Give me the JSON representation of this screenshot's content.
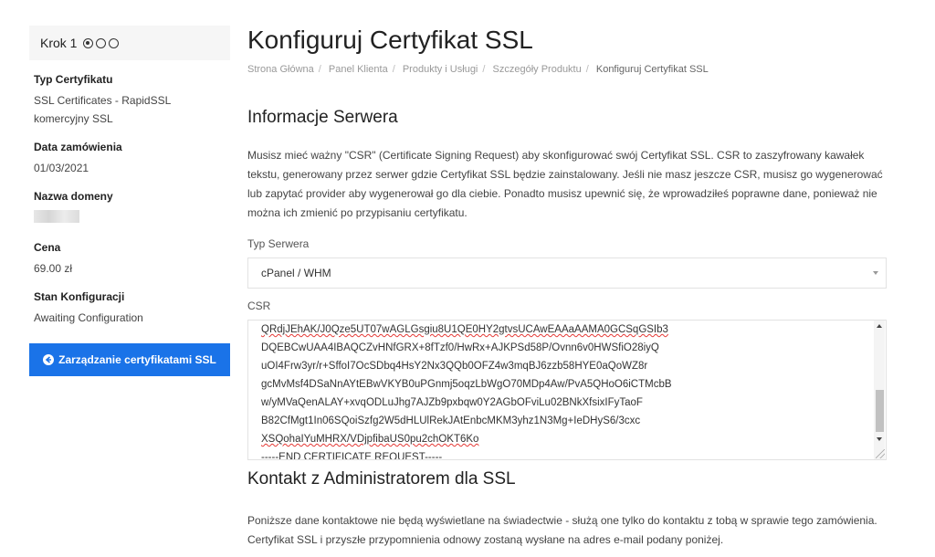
{
  "sidebar": {
    "step_label": "Krok 1",
    "step_indicators": [
      "filled",
      "empty",
      "empty"
    ],
    "certificate_type": {
      "title": "Typ Certyfikatu",
      "value": "SSL Certificates - RapidSSL komercyjny SSL"
    },
    "order_date": {
      "title": "Data zamówienia",
      "value": "01/03/2021"
    },
    "domain_name": {
      "title": "Nazwa domeny"
    },
    "price": {
      "title": "Cena",
      "value": "69.00 zł"
    },
    "config_status": {
      "title": "Stan Konfiguracji",
      "value": "Awaiting Configuration"
    },
    "manage_button": {
      "label": "Zarządzanie certyfikatami SSL",
      "icon": "arrow-left-circle-icon",
      "color": "#1a73e8"
    }
  },
  "main": {
    "title": "Konfiguruj Certyfikat SSL",
    "breadcrumb": [
      "Strona Główna",
      "Panel Klienta",
      "Produkty i Usługi",
      "Szczegóły Produktu",
      "Konfiguruj Certyfikat SSL"
    ],
    "server_info": {
      "heading": "Informacje Serwera",
      "description": "Musisz mieć ważny \"CSR\" (Certificate Signing Request) aby skonfigurować swój Certyfikat SSL. CSR to zaszyfrowany kawałek tekstu, generowany przez serwer gdzie Certyfikat SSL będzie zainstalowany. Jeśli nie masz jeszcze CSR, musisz go wygenerować lub zapytać provider aby wygenerował go dla ciebie. Ponadto musisz upewnić się, że wprowadziłeś poprawne dane, ponieważ nie można ich zmienić po przypisaniu certyfikatu.",
      "server_type_label": "Typ Serwera",
      "server_type_value": "cPanel / WHM",
      "csr_label": "CSR",
      "csr_lines": [
        "QRdjJEhAK/J0Qze5UT07wAGLGsgiu8U1QE0HY2gtvsUCAwEAAaAAMA0GCSqGSIb3",
        "DQEBCwUAA4IBAQCZvHNfGRX+8fTzf0/HwRx+AJKPSd58P/Ovnn6v0HWSfiO28iyQ",
        "uOI4Frw3yr/r+SffoI7OcSDbq4HsY2Nx3QQb0OFZ4w3mqBJ6zzb58HYE0aQoWZ8r",
        "gcMvMsf4DSaNnAYtEBwVKYB0uPGnmj5oqzLbWgO70MDp4Aw/PvA5QHoO6iCTMcbB",
        "w/yMVaQenALAY+xvqODLuJhg7AJZb9pxbqw0Y2AGbOFviLu02BNkXfsixIFyTaoF",
        "B82CfMgt1In06SQoiSzfg2W5dHLUlRekJAtEnbcMKM3yhz1N3Mg+IeDHyS6/3cxc",
        "XSQohaIYuMHRX/VDjpfibaUS0pu2chOKT6Ko",
        "-----END CERTIFICATE REQUEST-----"
      ]
    },
    "admin_contact": {
      "heading": "Kontakt z Administratorem dla SSL",
      "description": "Poniższe dane kontaktowe nie będą wyświetlane na świadectwie - służą one tylko do kontaktu z tobą w sprawie tego zamówienia. Certyfikat SSL i przyszłe przypomnienia odnowy zostaną wysłane na adres e-mail podany poniżej."
    }
  }
}
